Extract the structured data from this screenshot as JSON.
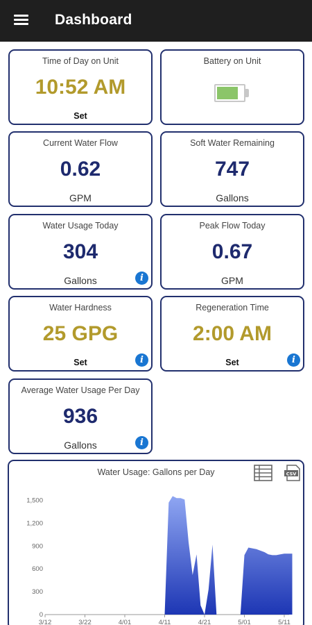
{
  "header": {
    "title": "Dashboard",
    "menu_icon": "menu-icon"
  },
  "cards": {
    "time": {
      "label": "Time of Day on Unit",
      "value": "10:52 AM",
      "action": "Set"
    },
    "battery": {
      "label": "Battery on Unit",
      "level": 0.8,
      "color": "#8bc569"
    },
    "flow": {
      "label": "Current Water Flow",
      "value": "0.62",
      "unit": "GPM"
    },
    "soft": {
      "label": "Soft Water Remaining",
      "value": "747",
      "unit": "Gallons"
    },
    "usage": {
      "label": "Water Usage Today",
      "value": "304",
      "unit": "Gallons"
    },
    "peak": {
      "label": "Peak Flow Today",
      "value": "0.67",
      "unit": "GPM"
    },
    "hardness": {
      "label": "Water Hardness",
      "value": "25 GPG",
      "action": "Set"
    },
    "regen": {
      "label": "Regeneration Time",
      "value": "2:00 AM",
      "action": "Set"
    },
    "average": {
      "label": "Average Water Usage Per Day",
      "value": "936",
      "unit": "Gallons"
    }
  },
  "colors": {
    "navy": "#1e2a6e",
    "gold": "#b29a2c",
    "info": "#1976d2",
    "chart_top": "#8fa6f2",
    "chart_bottom": "#1d36b4"
  },
  "chart_data": {
    "type": "area",
    "title": "Water Usage: Gallons per Day",
    "y_ticks": [
      "0",
      "300",
      "600",
      "900",
      "1,200",
      "1,500"
    ],
    "ylim": [
      0,
      1650
    ],
    "x_ticks": [
      "3/12",
      "3/22",
      "4/01",
      "4/11",
      "4/21",
      "5/01",
      "5/11"
    ],
    "x": [
      "4/11",
      "4/12",
      "4/13",
      "4/14",
      "4/15",
      "4/16",
      "4/17",
      "4/18",
      "4/19",
      "4/20",
      "4/21",
      "4/22",
      "4/23",
      "4/24",
      "4/25",
      "4/26",
      "4/27",
      "4/28",
      "4/29",
      "4/30",
      "5/01",
      "5/02",
      "5/03",
      "5/04",
      "5/05",
      "5/06",
      "5/07",
      "5/08",
      "5/09",
      "5/10",
      "5/11",
      "5/12",
      "5/13"
    ],
    "series": [
      {
        "values": [
          0,
          1470,
          1555,
          1530,
          1530,
          1510,
          950,
          520,
          790,
          120,
          0,
          330,
          920,
          0,
          0,
          0,
          0,
          0,
          0,
          0,
          780,
          880,
          870,
          860,
          840,
          820,
          790,
          780,
          780,
          790,
          800,
          800,
          800
        ]
      }
    ],
    "grid": false,
    "icons": [
      "table-icon",
      "csv-export-icon"
    ]
  }
}
